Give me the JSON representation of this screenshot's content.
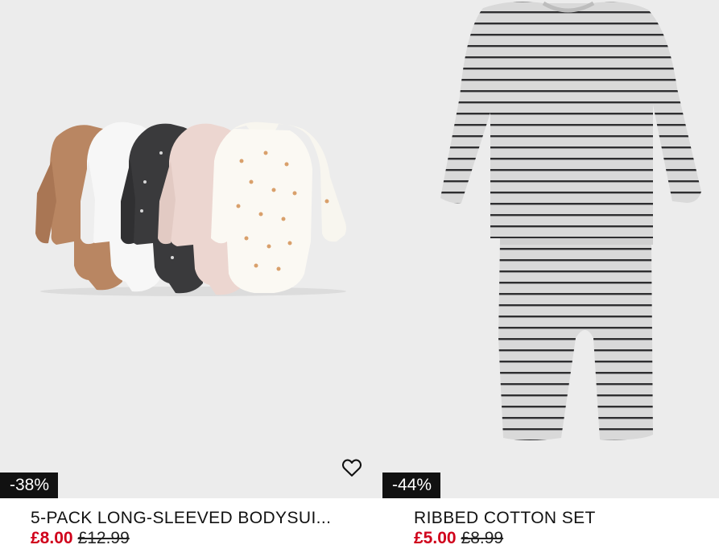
{
  "products": [
    {
      "discount_badge": "-38%",
      "title": "5-PACK LONG-SLEEVED BODYSUI...",
      "sale_price": "£8.00",
      "original_price": "£12.99",
      "image_icon": "bodysuit-pack-image",
      "favourite_icon": "heart-outline-icon"
    },
    {
      "discount_badge": "-44%",
      "title": "RIBBED COTTON SET",
      "sale_price": "£5.00",
      "original_price": "£8.99",
      "image_icon": "striped-set-image"
    }
  ],
  "colors": {
    "sale_red": "#d0021b",
    "badge_bg": "#111111",
    "image_bg": "#ececec"
  }
}
